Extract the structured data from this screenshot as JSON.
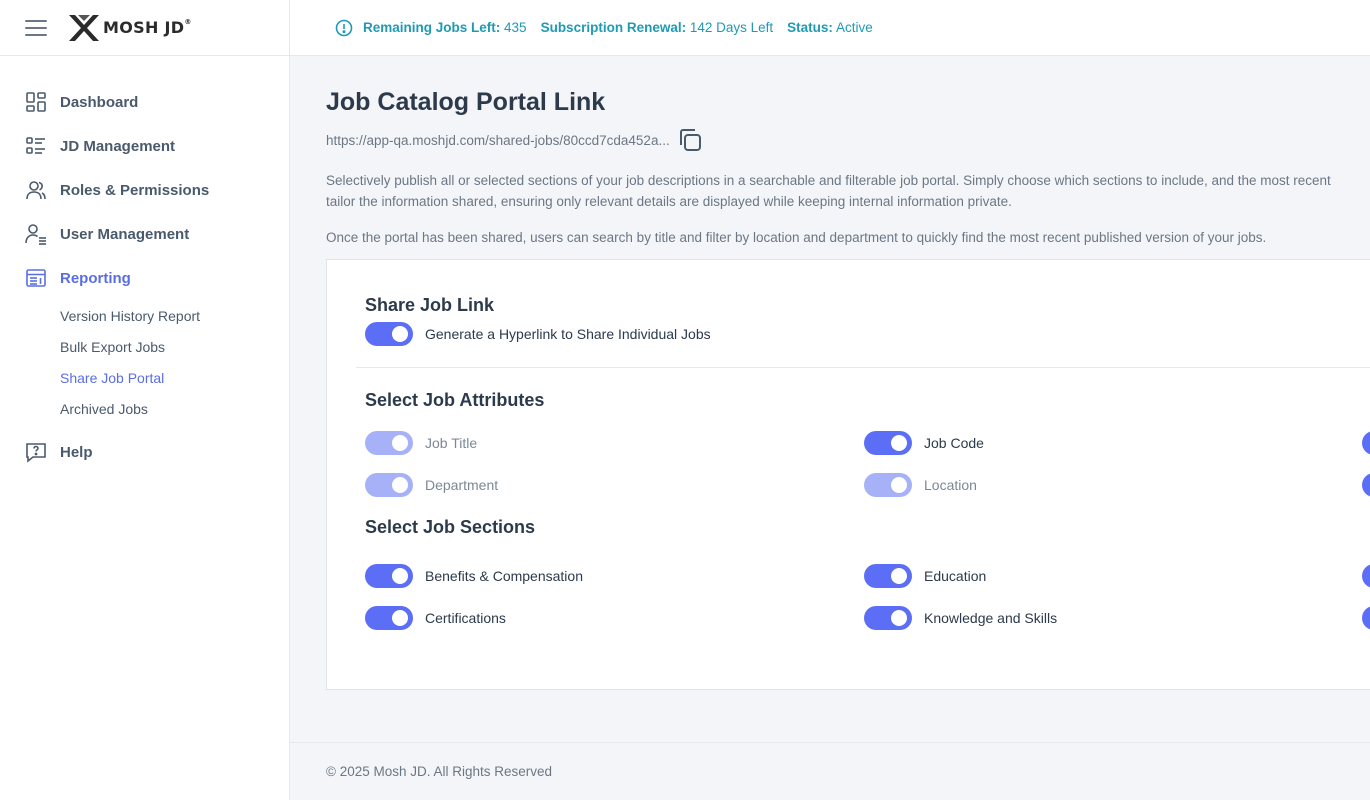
{
  "brand": {
    "name": "MOSH JD",
    "reg": "®"
  },
  "topbar": {
    "remaining_label": "Remaining Jobs Left:",
    "remaining_value": "435",
    "renewal_label": "Subscription Renewal:",
    "renewal_value": "142 Days Left",
    "status_label": "Status:",
    "status_value": "Active"
  },
  "sidebar": {
    "items": [
      {
        "label": "Dashboard",
        "icon": "dashboard-grid-icon"
      },
      {
        "label": "JD Management",
        "icon": "list-icon"
      },
      {
        "label": "Roles & Permissions",
        "icon": "users-icon"
      },
      {
        "label": "User Management",
        "icon": "user-list-icon"
      },
      {
        "label": "Reporting",
        "icon": "report-icon"
      },
      {
        "label": "Help",
        "icon": "help-chat-icon"
      }
    ],
    "reporting_sub": [
      {
        "label": "Version History Report"
      },
      {
        "label": "Bulk Export Jobs"
      },
      {
        "label": "Share Job Portal"
      },
      {
        "label": "Archived Jobs"
      }
    ]
  },
  "main": {
    "title": "Job Catalog Portal Link",
    "link": "https://app-qa.moshjd.com/shared-jobs/80ccd7cda452a...",
    "desc1_line1": "Selectively publish all or selected sections of your job descriptions in a searchable and filterable job portal. Simply choose which sections to include, and the most recent",
    "desc1_line2": "tailor the information shared, ensuring only relevant details are displayed while keeping internal information private.",
    "desc2": "Once the portal has been shared, users can search by title and filter by location and department to quickly find the most recent published version of your jobs."
  },
  "share": {
    "title": "Share Job Link",
    "toggle_label": "Generate a Hyperlink to Share Individual Jobs",
    "toggle_on": true
  },
  "attributes": {
    "title": "Select Job Attributes",
    "items": [
      {
        "label": "Job Title",
        "on": true,
        "locked": true
      },
      {
        "label": "Job Code",
        "on": true,
        "locked": false
      },
      {
        "label": "Department",
        "on": true,
        "locked": true
      },
      {
        "label": "Location",
        "on": true,
        "locked": true
      }
    ]
  },
  "sections": {
    "title": "Select Job Sections",
    "items": [
      {
        "label": "Benefits & Compensation",
        "on": true
      },
      {
        "label": "Education",
        "on": true
      },
      {
        "label": "Certifications",
        "on": true
      },
      {
        "label": "Knowledge and Skills",
        "on": true
      }
    ]
  },
  "footer": {
    "text": "© 2025 Mosh JD. All Rights Reserved"
  },
  "colors": {
    "accent": "#5b6ef5",
    "accent_dim": "#a7b1f8",
    "status_teal": "#1f9ab5",
    "nav_active": "#5b6ee1"
  }
}
